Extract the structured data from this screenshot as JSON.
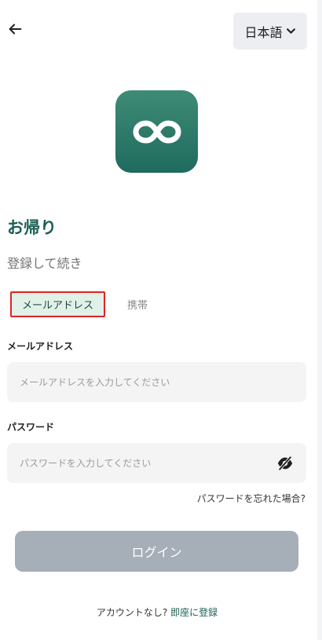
{
  "header": {
    "language_label": "日本語"
  },
  "brand": {
    "logo_color": "#2a7a68"
  },
  "heading": {
    "title": "お帰り",
    "subtitle": "登録して続き"
  },
  "tabs": [
    {
      "label": "メールアドレス",
      "selected": true
    },
    {
      "label": "携帯",
      "selected": false
    }
  ],
  "form": {
    "email_label": "メールアドレス",
    "email_placeholder": "メールアドレスを入力してください",
    "password_label": "パスワード",
    "password_placeholder": "パスワードを入力してください",
    "forgot_password": "パスワードを忘れた場合?",
    "login_button": "ログイン"
  },
  "footer": {
    "prompt": "アカウントなし? ",
    "register_link": "即座に登録"
  },
  "colors": {
    "accent": "#1c5f55",
    "tab_highlight": "#e2f1e8",
    "disabled_button": "#a6aeb8"
  }
}
